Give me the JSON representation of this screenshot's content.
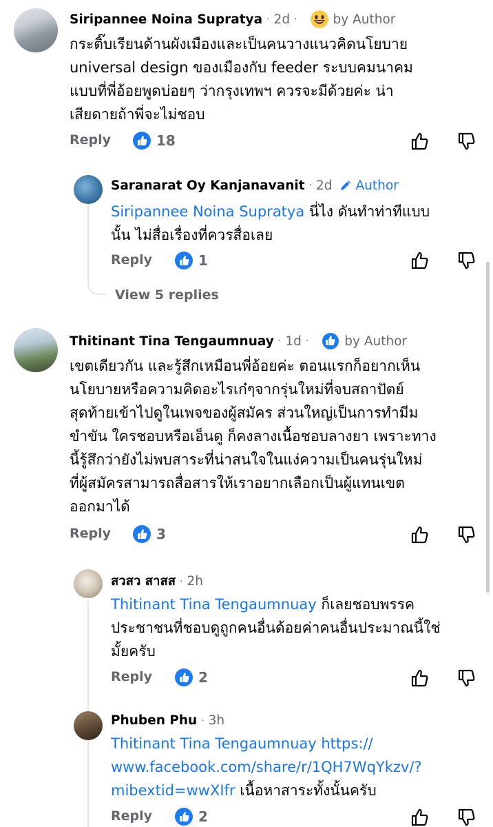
{
  "comments": [
    {
      "author": "Siripannee Noina Supratya",
      "time": "2d",
      "badge": "by Author",
      "text_lines": [
        "กระติ๊บเรียนด้านผังเมืองและเป็นคนวางแนวคิดนโยบาย",
        "universal design ของเมืองกับ feeder ระบบคมนาคม",
        "แบบที่พี่อ้อยพูดบ่อยๆ ว่ากรุงเทพฯ ควรจะมีด้วยค่ะ น่า",
        "เสียดายถ้าพี่จะไม่ชอบ"
      ],
      "reply_label": "Reply",
      "like_count": "18",
      "reply": {
        "author": "Saranarat Oy Kanjanavanit",
        "time": "2d",
        "badge": "Author",
        "mention": "Siripannee Noina Supratya",
        "text_after_mention": " นี่ไง ดันทำท่าทีแบบ",
        "text_line2": "นั้น ไม่สื่อเรื่องที่ควรสื่อเลย",
        "reply_label": "Reply",
        "like_count": "1"
      },
      "view_replies": "View 5 replies"
    },
    {
      "author": "Thitinant Tina Tengaumnuay",
      "time": "1d",
      "badge": "by Author",
      "text_lines": [
        "เขตเดียวกัน และรู้สึกเหมือนพี่อ้อยค่ะ ตอนแรกก็อยากเห็น",
        "นโยบายหรือความคิดอะไรเก๋ๆจากรุ่นใหม่ที่จบสถาปัตย์",
        "สุดท้ายเข้าไปดูในเพจของผู้สมัคร ส่วนใหญ่เป็นการทำมีม",
        "ขำขัน ใครชอบหรือเอ็นดู ก็คงลางเนื้อชอบลางยา เพราะทาง",
        "นี้รู้สึกว่ายังไม่พบสาระที่น่าสนใจในแง่ความเป็นคนรุ่นใหม่",
        "ที่ผู้สมัครสามารถสื่อสารให้เราอยากเลือกเป็นผู้แทนเขต",
        "ออกมาได้"
      ],
      "reply_label": "Reply",
      "like_count": "3",
      "replies": [
        {
          "author": "สวสว สาสส",
          "time": "2h",
          "mention": "Thitinant Tina Tengaumnuay",
          "text_after_mention": " ก็เลยชอบพรรค",
          "text_lines": [
            "ประชาชนที่ชอบดูถูกคนอื่นด้อยค่าคนอื่นประมาณนี้ใช่",
            "มั้ยครับ"
          ],
          "reply_label": "Reply",
          "like_count": "2"
        },
        {
          "author": "Phuben Phu",
          "time": "3h",
          "mention": "Thitinant Tina Tengaumnuay",
          "link_part1": " https://",
          "link_line2": "www.facebook.com/share/r/1QH7WqYkzv/?",
          "link_line3": "mibextid=wwXIfr",
          "text_after_link": " เนื้อหาสาระทั้งนั้นครับ",
          "reply_label": "Reply",
          "like_count": "2"
        }
      ]
    }
  ],
  "colors": {
    "accent": "#1876f2",
    "secondary_text": "#65676b",
    "thread_line": "#e4e6eb"
  }
}
